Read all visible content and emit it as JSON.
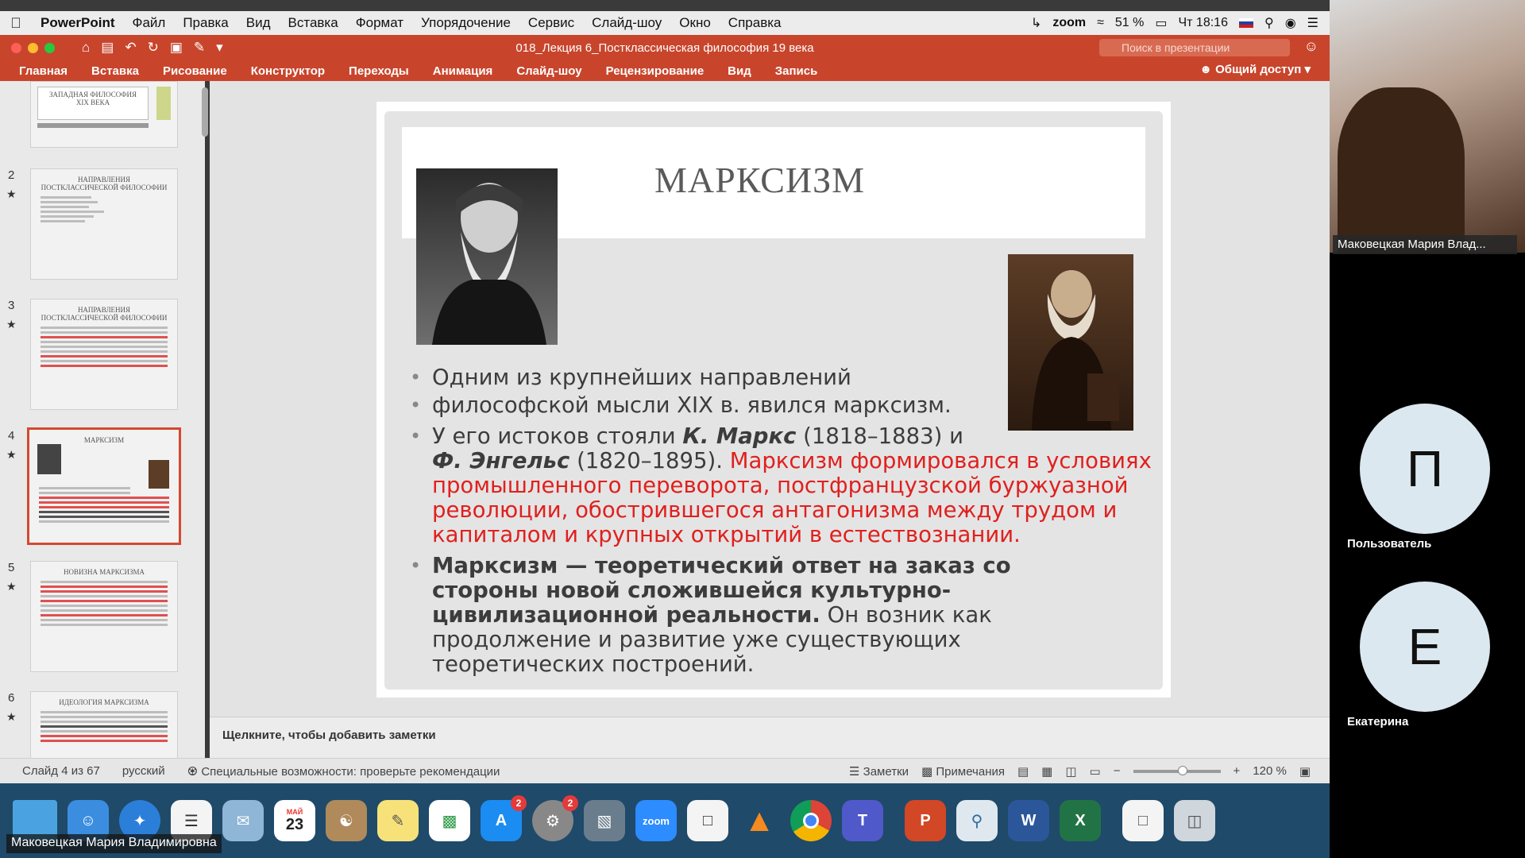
{
  "menubar": {
    "app": "PowerPoint",
    "items": [
      "Файл",
      "Правка",
      "Вид",
      "Вставка",
      "Формат",
      "Упорядочение",
      "Сервис",
      "Слайд-шоу",
      "Окно",
      "Справка"
    ],
    "zoom_label": "zoom",
    "battery": "51 %",
    "clock": "Чт 18:16"
  },
  "window": {
    "title": "018_Лекция 6_Постклассическая философия 19 века",
    "search_placeholder": "Поиск в презентации"
  },
  "ribbon": {
    "tabs": [
      "Главная",
      "Вставка",
      "Рисование",
      "Конструктор",
      "Переходы",
      "Анимация",
      "Слайд-шоу",
      "Рецензирование",
      "Вид",
      "Запись"
    ],
    "share": "Общий доступ"
  },
  "thumbnails": [
    {
      "num": "",
      "title": "ЗАПАДНАЯ ФИЛОСОФИЯ XIX ВЕКА"
    },
    {
      "num": "2",
      "title": "НАПРАВЛЕНИЯ ПОСТКЛАССИЧЕСКОЙ ФИЛОСОФИИ"
    },
    {
      "num": "3",
      "title": "НАПРАВЛЕНИЯ ПОСТКЛАССИЧЕСКОЙ ФИЛОСОФИИ"
    },
    {
      "num": "4",
      "title": "МАРКСИЗМ"
    },
    {
      "num": "5",
      "title": "НОВИЗНА МАРКСИЗМА"
    },
    {
      "num": "6",
      "title": "ИДЕОЛОГИЯ МАРКСИЗМА"
    }
  ],
  "slide": {
    "title": "МАРКСИЗМ",
    "b1": "Одним из крупнейших направлений",
    "b2": "философской мысли XIX в. явился марксизм.",
    "b3_pre": "У его истоков стояли ",
    "b3_marx": "К. Маркс",
    "b3_marx_years": " (1818–1883) и",
    "b3_engels": "Ф. Энгельс",
    "b3_engels_years": " (1820–1895). ",
    "b3_red": "Марксизм формировался в условиях промышленного переворота, постфранцузской буржуазной революции, обострившегося антагонизма между трудом и капиталом и крупных открытий в естествознании.",
    "b4_bold": "Марксизм — теоретический ответ на заказ со стороны новой сложившейся культурно-цивилизационной реальности.",
    "b4_rest": " Он возник как продолжение и развитие уже существующих теоретических построений."
  },
  "notes_placeholder": "Щелкните, чтобы добавить заметки",
  "status": {
    "slide_counter": "Слайд 4 из 67",
    "language": "русский",
    "accessibility": "Специальные возможности: проверьте рекомендации",
    "notes": "Заметки",
    "comments": "Примечания",
    "zoom": "120 %"
  },
  "dock": {
    "calendar_month": "МАЙ",
    "calendar_day": "23",
    "appstore_badge": "2",
    "settings_badge": "2",
    "zoom_label": "zoom"
  },
  "zoom_meeting": {
    "self_name": "Маковецкая Мария Владимировна",
    "video_name": "Маковецкая Мария Влад...",
    "participants": [
      {
        "initial": "П",
        "name": "Пользователь"
      },
      {
        "initial": "Е",
        "name": "Екатерина"
      }
    ]
  }
}
